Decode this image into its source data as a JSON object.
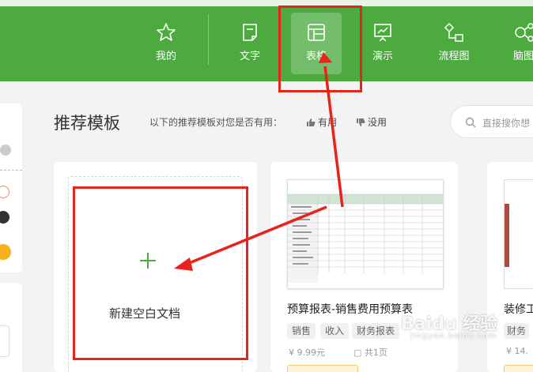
{
  "nav": {
    "items": [
      {
        "label": "我的",
        "icon": "star-icon"
      },
      {
        "label": "文字",
        "icon": "document-icon"
      },
      {
        "label": "表格",
        "icon": "table-icon"
      },
      {
        "label": "演示",
        "icon": "presentation-icon"
      },
      {
        "label": "流程图",
        "icon": "flowchart-icon"
      },
      {
        "label": "脑图",
        "icon": "mindmap-icon"
      }
    ],
    "active": "表格"
  },
  "header": {
    "title": "推荐模板",
    "hint": "以下的推荐模板对您是否有用：",
    "useful": "有用",
    "useless": "没用"
  },
  "search": {
    "placeholder": "直接搜你想"
  },
  "blank": {
    "label": "新建空白文档"
  },
  "templates": [
    {
      "title": "预算报表-销售费用预算表",
      "tags": [
        "销售",
        "收入",
        "财务报表"
      ],
      "price": "9.99元",
      "pages": "共1页"
    },
    {
      "title": "装修工",
      "tags": [
        "财务"
      ],
      "price": "14."
    }
  ],
  "watermark": {
    "text": "Baidu 经验",
    "sub": "jingyan.baidu.com"
  },
  "colors": {
    "brand": "#4caa3f",
    "annotation": "#e8231a",
    "accent_plus": "#4caa3f"
  }
}
